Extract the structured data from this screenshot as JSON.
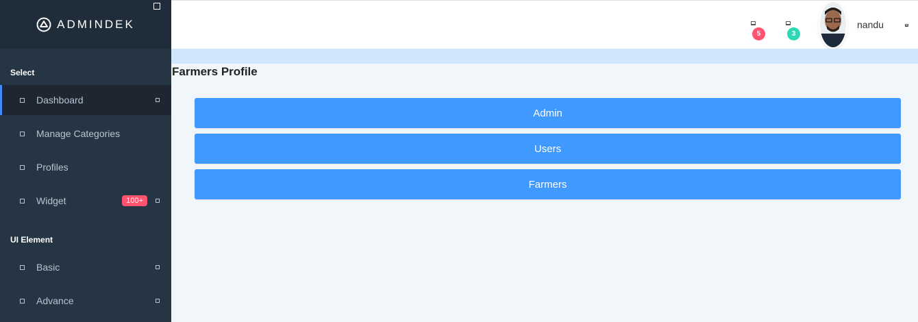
{
  "brand": {
    "name": "ADMINDEK"
  },
  "sidebar": {
    "sections": [
      {
        "label": "Select"
      },
      {
        "label": "UI Element"
      }
    ],
    "items": [
      {
        "label": "Dashboard",
        "icon": "square-icon",
        "active": true,
        "has_arrow": true
      },
      {
        "label": "Manage Categories",
        "icon": "square-icon"
      },
      {
        "label": "Profiles",
        "icon": "square-icon"
      },
      {
        "label": "Widget",
        "icon": "square-icon",
        "badge": "100+",
        "has_arrow": true
      },
      {
        "label": "Basic",
        "icon": "square-icon",
        "has_arrow": true
      },
      {
        "label": "Advance",
        "icon": "square-icon",
        "has_arrow": true
      }
    ]
  },
  "header": {
    "notifications": {
      "icon": "bell-icon",
      "count": "5",
      "color": "#ff5370"
    },
    "messages": {
      "icon": "message-icon",
      "count": "3",
      "color": "#2ed8b6"
    },
    "user": {
      "name": "nandu"
    }
  },
  "main": {
    "title": "Farmers Profile",
    "buttons": [
      {
        "label": "Admin"
      },
      {
        "label": "Users"
      },
      {
        "label": "Farmers"
      }
    ],
    "accent_color": "#4099ff"
  }
}
